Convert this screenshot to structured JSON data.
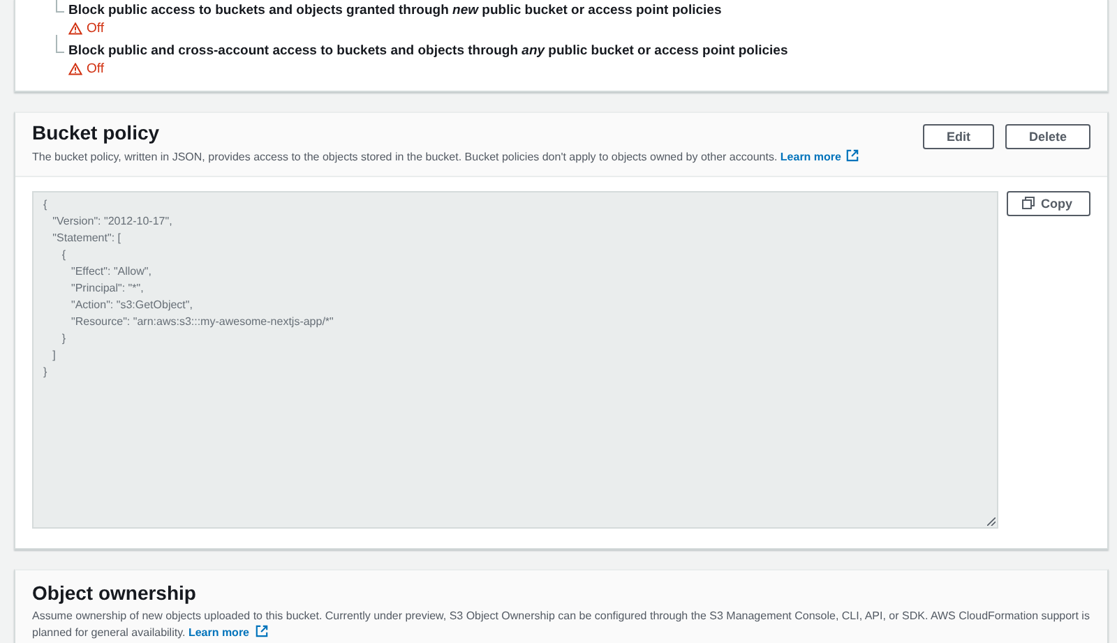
{
  "access_settings": [
    {
      "label": "Block public access to buckets and objects granted through *new* public bucket or access point policies",
      "status": "Off",
      "warning": true
    },
    {
      "label": "Block public and cross-account access to buckets and objects through *any* public bucket or access point policies",
      "status": "Off",
      "warning": true
    }
  ],
  "bucket_policy": {
    "title": "Bucket policy",
    "description": "The bucket policy, written in JSON, provides access to the objects stored in the bucket. Bucket policies don't apply to objects owned by other accounts.",
    "learn_more": "Learn more",
    "buttons": [
      "Edit",
      "Delete"
    ],
    "copy_button": "Copy",
    "policy_lines": [
      "{",
      "   \"Version\": \"2012-10-17\",",
      "   \"Statement\": [",
      "      {",
      "         \"Effect\": \"Allow\",",
      "         \"Principal\": \"*\",",
      "         \"Action\": \"s3:GetObject\",",
      "         \"Resource\": \"arn:aws:s3:::my-awesome-nextjs-app/*\"",
      "      }",
      "   ]",
      "}"
    ]
  },
  "object_ownership": {
    "title": "Object ownership",
    "description": "Assume ownership of new objects uploaded to this bucket. Currently under preview, S3 Object Ownership can be configured through the S3 Management Console, CLI, API, or SDK. AWS CloudFormation support is planned for general availability.",
    "learn_more": "Learn more"
  }
}
